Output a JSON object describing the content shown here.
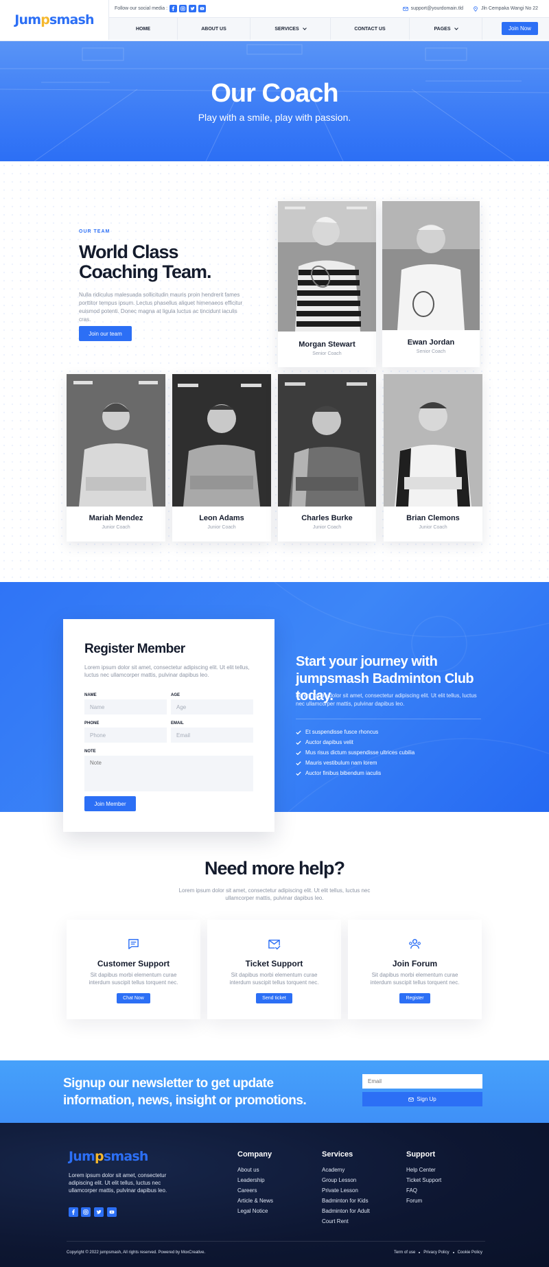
{
  "brand": {
    "name": "Jumpsmash",
    "accent": "#2c6ff5",
    "dark": "#0d1631"
  },
  "topbar": {
    "follow_label": "Follow our social media :",
    "email": "support@yourdomain.tld",
    "address": "Jln Cempaka Wangi No 22",
    "social_icons": [
      "facebook-icon",
      "instagram-icon",
      "twitter-icon",
      "youtube-icon"
    ]
  },
  "nav": {
    "items": [
      {
        "label": "HOME"
      },
      {
        "label": "ABOUT US"
      },
      {
        "label": "SERVICES",
        "dropdown": true
      },
      {
        "label": "CONTACT US"
      },
      {
        "label": "PAGES",
        "dropdown": true
      }
    ],
    "cta": "Join Now"
  },
  "hero": {
    "title": "Our Coach",
    "subtitle": "Play with a smile, play with passion."
  },
  "team": {
    "eyebrow": "OUR TEAM",
    "title": "World Class Coaching Team.",
    "description": "Nulla ridiculus malesuada sollicitudin mauris proin hendrerit fames porttitor tempus ipsum. Lectus phasellus aliquet himenaeos efficitur euismod potenti. Donec magna at ligula luctus ac tincidunt iaculis cras.",
    "button": "Join our team",
    "coaches": [
      {
        "name": "Morgan Stewart",
        "role": "Senior Coach"
      },
      {
        "name": "Ewan Jordan",
        "role": "Senior Coach"
      },
      {
        "name": "Mariah Mendez",
        "role": "Junior Coach"
      },
      {
        "name": "Leon Adams",
        "role": "Junior Coach"
      },
      {
        "name": "Charles Burke",
        "role": "Junior Coach"
      },
      {
        "name": "Brian Clemons",
        "role": "Junior Coach"
      }
    ]
  },
  "register": {
    "title": "Register Member",
    "description": "Lorem ipsum dolor sit amet, consectetur adipiscing elit. Ut elit tellus, luctus nec ullamcorper mattis, pulvinar dapibus leo.",
    "fields": {
      "name": {
        "label": "NAME",
        "placeholder": "Name"
      },
      "age": {
        "label": "AGE",
        "placeholder": "Age"
      },
      "phone": {
        "label": "PHONE",
        "placeholder": "Phone"
      },
      "email": {
        "label": "EMAIL",
        "placeholder": "Email"
      },
      "note": {
        "label": "NOTE",
        "placeholder": "Note"
      }
    },
    "button": "Join Member",
    "promo_title": "Start your journey with jumpsmash Badminton Club today.",
    "promo_desc": "Lorem ipsum dolor sit amet, consectetur adipiscing elit. Ut elit tellus, luctus nec ullamcorper mattis, pulvinar dapibus leo.",
    "benefits": [
      "Et suspendisse fusce rhoncus",
      "Auctor dapibus velit",
      "Mus risus dictum suspendisse ultrices cubilia",
      "Mauris vestibulum nam lorem",
      "Auctor finibus bibendum iaculis"
    ]
  },
  "help": {
    "title": "Need more help?",
    "description": "Lorem ipsum dolor sit amet, consectetur adipiscing elit. Ut elit tellus, luctus nec ullamcorper mattis, pulvinar dapibus leo.",
    "cards": [
      {
        "icon": "chat-icon",
        "title": "Customer Support",
        "desc": "Sit dapibus morbi elementum curae interdum suscipit tellus torquent nec.",
        "button": "Chat Now"
      },
      {
        "icon": "mail-check-icon",
        "title": "Ticket Support",
        "desc": "Sit dapibus morbi elementum curae interdum suscipit tellus torquent nec.",
        "button": "Send ticket"
      },
      {
        "icon": "users-icon",
        "title": "Join Forum",
        "desc": "Sit dapibus morbi elementum curae interdum suscipit tellus torquent nec.",
        "button": "Register"
      }
    ]
  },
  "newsletter": {
    "title": "Signup our newsletter to get update information, news, insight or promotions.",
    "placeholder": "Email",
    "button": "Sign Up"
  },
  "footer": {
    "description": "Lorem ipsum dolor sit amet, consectetur adipiscing elit. Ut elit tellus, luctus nec ullamcorper mattis, pulvinar dapibus leo.",
    "columns": [
      {
        "title": "Company",
        "items": [
          "About us",
          "Leadership",
          "Careers",
          "Article & News",
          "Legal Notice"
        ]
      },
      {
        "title": "Services",
        "items": [
          "Academy",
          "Group Lesson",
          "Private Lesson",
          "Badminton for Kids",
          "Badminton for Adult",
          "Court Rent"
        ]
      },
      {
        "title": "Support",
        "items": [
          "Help Center",
          "Ticket Support",
          "FAQ",
          "Forum"
        ]
      }
    ],
    "copyright": "Copyright © 2022 jumpsmash, All rights reserved. Powered by MoxCreative.",
    "legal": [
      "Term of use",
      "Privacy Policy",
      "Cookie Policy"
    ]
  }
}
